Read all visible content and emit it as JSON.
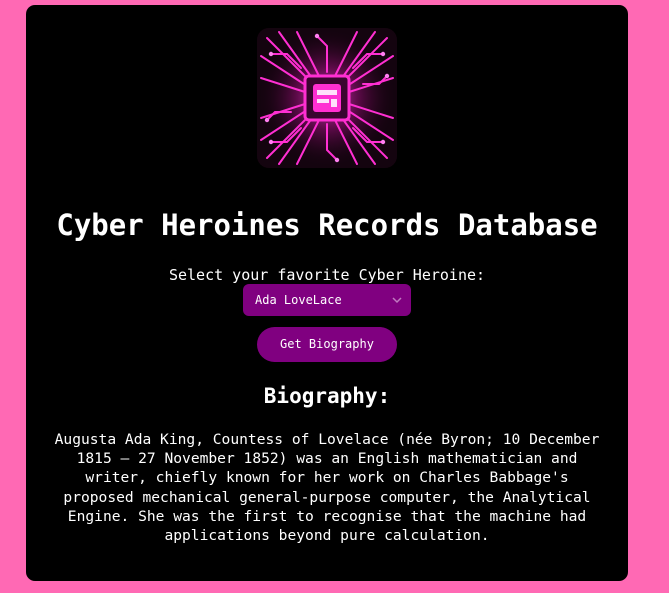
{
  "app": {
    "title": "Cyber Heroines Records Database",
    "logo_icon": "circuit-chip-logo-icon"
  },
  "form": {
    "select_label": "Select your favorite Cyber Heroine:",
    "selected_heroine": "Ada LoveLace",
    "button_label": "Get Biography"
  },
  "biography": {
    "heading": "Biography:",
    "text": "Augusta Ada King, Countess of Lovelace (née Byron; 10 December 1815 – 27 November 1852) was an English mathematician and writer, chiefly known for her work on Charles Babbage's proposed mechanical general-purpose computer, the Analytical Engine. She was the first to recognise that the machine had applications beyond pure calculation."
  },
  "colors": {
    "page_background": "#ff69b4",
    "card_background": "#000000",
    "accent": "#800080",
    "neon": "#ff2fd2",
    "text": "#ffffff"
  }
}
